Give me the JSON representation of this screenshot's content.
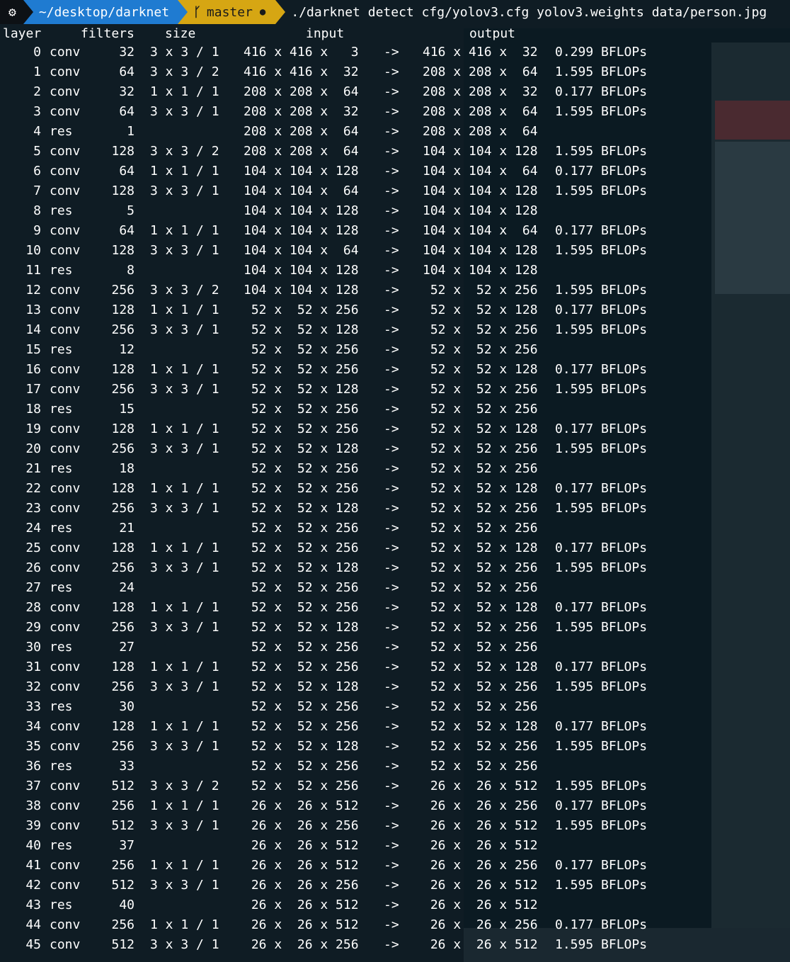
{
  "prompt": {
    "os_icon": "⚙",
    "path": "~/desktop/darknet",
    "branch": "master",
    "dirty_indicator": "●",
    "command": "./darknet detect cfg/yolov3.cfg yolov3.weights data/person.jpg"
  },
  "headers": {
    "layer": "layer",
    "filters": "filters",
    "size": "size",
    "input": "input",
    "output": "output"
  },
  "rows": [
    {
      "n": "0",
      "t": "conv",
      "f": "32",
      "s": "3 x 3 / 1",
      "i": "416 x 416 x   3",
      "a": "->",
      "o": "416 x 416 x  32",
      "b": "0.299 BFLOPs"
    },
    {
      "n": "1",
      "t": "conv",
      "f": "64",
      "s": "3 x 3 / 2",
      "i": "416 x 416 x  32",
      "a": "->",
      "o": "208 x 208 x  64",
      "b": "1.595 BFLOPs"
    },
    {
      "n": "2",
      "t": "conv",
      "f": "32",
      "s": "1 x 1 / 1",
      "i": "208 x 208 x  64",
      "a": "->",
      "o": "208 x 208 x  32",
      "b": "0.177 BFLOPs"
    },
    {
      "n": "3",
      "t": "conv",
      "f": "64",
      "s": "3 x 3 / 1",
      "i": "208 x 208 x  32",
      "a": "->",
      "o": "208 x 208 x  64",
      "b": "1.595 BFLOPs"
    },
    {
      "n": "4",
      "t": "res",
      "f": "1",
      "s": "",
      "i": "208 x 208 x  64",
      "a": "->",
      "o": "208 x 208 x  64",
      "b": ""
    },
    {
      "n": "5",
      "t": "conv",
      "f": "128",
      "s": "3 x 3 / 2",
      "i": "208 x 208 x  64",
      "a": "->",
      "o": "104 x 104 x 128",
      "b": "1.595 BFLOPs"
    },
    {
      "n": "6",
      "t": "conv",
      "f": "64",
      "s": "1 x 1 / 1",
      "i": "104 x 104 x 128",
      "a": "->",
      "o": "104 x 104 x  64",
      "b": "0.177 BFLOPs"
    },
    {
      "n": "7",
      "t": "conv",
      "f": "128",
      "s": "3 x 3 / 1",
      "i": "104 x 104 x  64",
      "a": "->",
      "o": "104 x 104 x 128",
      "b": "1.595 BFLOPs"
    },
    {
      "n": "8",
      "t": "res",
      "f": "5",
      "s": "",
      "i": "104 x 104 x 128",
      "a": "->",
      "o": "104 x 104 x 128",
      "b": ""
    },
    {
      "n": "9",
      "t": "conv",
      "f": "64",
      "s": "1 x 1 / 1",
      "i": "104 x 104 x 128",
      "a": "->",
      "o": "104 x 104 x  64",
      "b": "0.177 BFLOPs"
    },
    {
      "n": "10",
      "t": "conv",
      "f": "128",
      "s": "3 x 3 / 1",
      "i": "104 x 104 x  64",
      "a": "->",
      "o": "104 x 104 x 128",
      "b": "1.595 BFLOPs"
    },
    {
      "n": "11",
      "t": "res",
      "f": "8",
      "s": "",
      "i": "104 x 104 x 128",
      "a": "->",
      "o": "104 x 104 x 128",
      "b": ""
    },
    {
      "n": "12",
      "t": "conv",
      "f": "256",
      "s": "3 x 3 / 2",
      "i": "104 x 104 x 128",
      "a": "->",
      "o": " 52 x  52 x 256",
      "b": "1.595 BFLOPs"
    },
    {
      "n": "13",
      "t": "conv",
      "f": "128",
      "s": "1 x 1 / 1",
      "i": " 52 x  52 x 256",
      "a": "->",
      "o": " 52 x  52 x 128",
      "b": "0.177 BFLOPs"
    },
    {
      "n": "14",
      "t": "conv",
      "f": "256",
      "s": "3 x 3 / 1",
      "i": " 52 x  52 x 128",
      "a": "->",
      "o": " 52 x  52 x 256",
      "b": "1.595 BFLOPs"
    },
    {
      "n": "15",
      "t": "res",
      "f": "12",
      "s": "",
      "i": " 52 x  52 x 256",
      "a": "->",
      "o": " 52 x  52 x 256",
      "b": ""
    },
    {
      "n": "16",
      "t": "conv",
      "f": "128",
      "s": "1 x 1 / 1",
      "i": " 52 x  52 x 256",
      "a": "->",
      "o": " 52 x  52 x 128",
      "b": "0.177 BFLOPs"
    },
    {
      "n": "17",
      "t": "conv",
      "f": "256",
      "s": "3 x 3 / 1",
      "i": " 52 x  52 x 128",
      "a": "->",
      "o": " 52 x  52 x 256",
      "b": "1.595 BFLOPs"
    },
    {
      "n": "18",
      "t": "res",
      "f": "15",
      "s": "",
      "i": " 52 x  52 x 256",
      "a": "->",
      "o": " 52 x  52 x 256",
      "b": ""
    },
    {
      "n": "19",
      "t": "conv",
      "f": "128",
      "s": "1 x 1 / 1",
      "i": " 52 x  52 x 256",
      "a": "->",
      "o": " 52 x  52 x 128",
      "b": "0.177 BFLOPs"
    },
    {
      "n": "20",
      "t": "conv",
      "f": "256",
      "s": "3 x 3 / 1",
      "i": " 52 x  52 x 128",
      "a": "->",
      "o": " 52 x  52 x 256",
      "b": "1.595 BFLOPs"
    },
    {
      "n": "21",
      "t": "res",
      "f": "18",
      "s": "",
      "i": " 52 x  52 x 256",
      "a": "->",
      "o": " 52 x  52 x 256",
      "b": ""
    },
    {
      "n": "22",
      "t": "conv",
      "f": "128",
      "s": "1 x 1 / 1",
      "i": " 52 x  52 x 256",
      "a": "->",
      "o": " 52 x  52 x 128",
      "b": "0.177 BFLOPs"
    },
    {
      "n": "23",
      "t": "conv",
      "f": "256",
      "s": "3 x 3 / 1",
      "i": " 52 x  52 x 128",
      "a": "->",
      "o": " 52 x  52 x 256",
      "b": "1.595 BFLOPs"
    },
    {
      "n": "24",
      "t": "res",
      "f": "21",
      "s": "",
      "i": " 52 x  52 x 256",
      "a": "->",
      "o": " 52 x  52 x 256",
      "b": ""
    },
    {
      "n": "25",
      "t": "conv",
      "f": "128",
      "s": "1 x 1 / 1",
      "i": " 52 x  52 x 256",
      "a": "->",
      "o": " 52 x  52 x 128",
      "b": "0.177 BFLOPs"
    },
    {
      "n": "26",
      "t": "conv",
      "f": "256",
      "s": "3 x 3 / 1",
      "i": " 52 x  52 x 128",
      "a": "->",
      "o": " 52 x  52 x 256",
      "b": "1.595 BFLOPs"
    },
    {
      "n": "27",
      "t": "res",
      "f": "24",
      "s": "",
      "i": " 52 x  52 x 256",
      "a": "->",
      "o": " 52 x  52 x 256",
      "b": ""
    },
    {
      "n": "28",
      "t": "conv",
      "f": "128",
      "s": "1 x 1 / 1",
      "i": " 52 x  52 x 256",
      "a": "->",
      "o": " 52 x  52 x 128",
      "b": "0.177 BFLOPs"
    },
    {
      "n": "29",
      "t": "conv",
      "f": "256",
      "s": "3 x 3 / 1",
      "i": " 52 x  52 x 128",
      "a": "->",
      "o": " 52 x  52 x 256",
      "b": "1.595 BFLOPs"
    },
    {
      "n": "30",
      "t": "res",
      "f": "27",
      "s": "",
      "i": " 52 x  52 x 256",
      "a": "->",
      "o": " 52 x  52 x 256",
      "b": ""
    },
    {
      "n": "31",
      "t": "conv",
      "f": "128",
      "s": "1 x 1 / 1",
      "i": " 52 x  52 x 256",
      "a": "->",
      "o": " 52 x  52 x 128",
      "b": "0.177 BFLOPs"
    },
    {
      "n": "32",
      "t": "conv",
      "f": "256",
      "s": "3 x 3 / 1",
      "i": " 52 x  52 x 128",
      "a": "->",
      "o": " 52 x  52 x 256",
      "b": "1.595 BFLOPs"
    },
    {
      "n": "33",
      "t": "res",
      "f": "30",
      "s": "",
      "i": " 52 x  52 x 256",
      "a": "->",
      "o": " 52 x  52 x 256",
      "b": ""
    },
    {
      "n": "34",
      "t": "conv",
      "f": "128",
      "s": "1 x 1 / 1",
      "i": " 52 x  52 x 256",
      "a": "->",
      "o": " 52 x  52 x 128",
      "b": "0.177 BFLOPs"
    },
    {
      "n": "35",
      "t": "conv",
      "f": "256",
      "s": "3 x 3 / 1",
      "i": " 52 x  52 x 128",
      "a": "->",
      "o": " 52 x  52 x 256",
      "b": "1.595 BFLOPs"
    },
    {
      "n": "36",
      "t": "res",
      "f": "33",
      "s": "",
      "i": " 52 x  52 x 256",
      "a": "->",
      "o": " 52 x  52 x 256",
      "b": ""
    },
    {
      "n": "37",
      "t": "conv",
      "f": "512",
      "s": "3 x 3 / 2",
      "i": " 52 x  52 x 256",
      "a": "->",
      "o": " 26 x  26 x 512",
      "b": "1.595 BFLOPs"
    },
    {
      "n": "38",
      "t": "conv",
      "f": "256",
      "s": "1 x 1 / 1",
      "i": " 26 x  26 x 512",
      "a": "->",
      "o": " 26 x  26 x 256",
      "b": "0.177 BFLOPs"
    },
    {
      "n": "39",
      "t": "conv",
      "f": "512",
      "s": "3 x 3 / 1",
      "i": " 26 x  26 x 256",
      "a": "->",
      "o": " 26 x  26 x 512",
      "b": "1.595 BFLOPs"
    },
    {
      "n": "40",
      "t": "res",
      "f": "37",
      "s": "",
      "i": " 26 x  26 x 512",
      "a": "->",
      "o": " 26 x  26 x 512",
      "b": ""
    },
    {
      "n": "41",
      "t": "conv",
      "f": "256",
      "s": "1 x 1 / 1",
      "i": " 26 x  26 x 512",
      "a": "->",
      "o": " 26 x  26 x 256",
      "b": "0.177 BFLOPs"
    },
    {
      "n": "42",
      "t": "conv",
      "f": "512",
      "s": "3 x 3 / 1",
      "i": " 26 x  26 x 256",
      "a": "->",
      "o": " 26 x  26 x 512",
      "b": "1.595 BFLOPs"
    },
    {
      "n": "43",
      "t": "res",
      "f": "40",
      "s": "",
      "i": " 26 x  26 x 512",
      "a": "->",
      "o": " 26 x  26 x 512",
      "b": ""
    },
    {
      "n": "44",
      "t": "conv",
      "f": "256",
      "s": "1 x 1 / 1",
      "i": " 26 x  26 x 512",
      "a": "->",
      "o": " 26 x  26 x 256",
      "b": "0.177 BFLOPs"
    },
    {
      "n": "45",
      "t": "conv",
      "f": "512",
      "s": "3 x 3 / 1",
      "i": " 26 x  26 x 256",
      "a": "->",
      "o": " 26 x  26 x 512",
      "b": "1.595 BFLOPs"
    }
  ]
}
